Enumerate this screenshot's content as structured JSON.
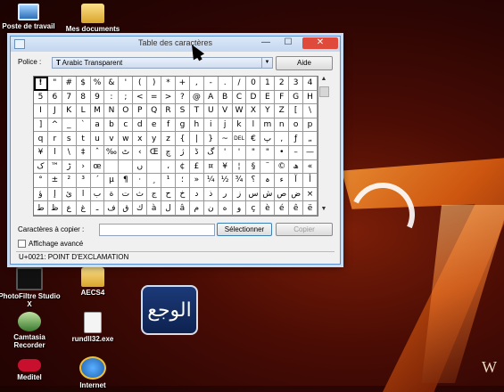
{
  "desktop": {
    "icons": [
      {
        "label": "Poste de travail",
        "icon": "computer-icon"
      },
      {
        "label": "Mes documents",
        "icon": "folder-icon"
      },
      {
        "label": "PhotoFiltre Studio X",
        "icon": "photofiltre-icon"
      },
      {
        "label": "AECS4",
        "icon": "folder-icon"
      },
      {
        "label": "Camtasia Recorder",
        "icon": "camtasia-icon"
      },
      {
        "label": "rundll32.exe",
        "icon": "exe-file-icon"
      },
      {
        "label": "Meditel",
        "icon": "meditel-icon"
      },
      {
        "label": "Internet",
        "icon": "internet-explorer-icon"
      }
    ],
    "logo_text": "الوجع",
    "corner_text": "W"
  },
  "window": {
    "title": "Table des caractères",
    "controls": {
      "minimize": "—",
      "maximize": "☐",
      "close": "✕"
    },
    "font_label": "Police :",
    "font_value": "Arabic Transparent",
    "font_icon": "truetype-icon",
    "help_label": "Aide",
    "characters": [
      "!",
      "\"",
      "#",
      "$",
      "%",
      "&",
      "'",
      "(",
      ")",
      "*",
      "+",
      ",",
      "-",
      ".",
      "/",
      "0",
      "1",
      "2",
      "3",
      "4",
      "5",
      "6",
      "7",
      "8",
      "9",
      ":",
      ";",
      "<",
      "=",
      ">",
      "?",
      "@",
      "A",
      "B",
      "C",
      "D",
      "E",
      "F",
      "G",
      "H",
      "I",
      "J",
      "K",
      "L",
      "M",
      "N",
      "O",
      "P",
      "Q",
      "R",
      "S",
      "T",
      "U",
      "V",
      "W",
      "X",
      "Y",
      "Z",
      "[",
      "\\",
      "]",
      "^",
      "_",
      "`",
      "a",
      "b",
      "c",
      "d",
      "e",
      "f",
      "g",
      "h",
      "i",
      "j",
      "k",
      "l",
      "m",
      "n",
      "o",
      "p",
      "q",
      "r",
      "s",
      "t",
      "u",
      "v",
      "w",
      "x",
      "y",
      "z",
      "{",
      "|",
      "}",
      "~",
      "DEL",
      "€",
      "پ",
      "‚",
      "ƒ",
      "„",
      "¥",
      "ا",
      "\\",
      "‡",
      "ˆ",
      "‰",
      "ٹ",
      "‹",
      "Œ",
      "چ",
      "ژ",
      "ڈ",
      "گ",
      "'",
      "'",
      "\"",
      "\"",
      "•",
      "–",
      "—",
      "ک",
      "™",
      "ڑ",
      "›",
      "œ",
      "‌",
      "‍",
      "ں",
      " ",
      "،",
      "¢",
      "£",
      "¤",
      "¥",
      "¦",
      "§",
      "¨",
      "©",
      "ھ",
      "«",
      "°",
      "±",
      "²",
      "³",
      "´",
      "µ",
      "¶",
      "·",
      "¸",
      "¹",
      "؛",
      "»",
      "¼",
      "½",
      "¾",
      "؟",
      "ہ",
      "ء",
      "آ",
      "أ",
      "ؤ",
      "إ",
      "ئ",
      "ا",
      "ب",
      "ة",
      "ت",
      "ث",
      "ج",
      "ح",
      "خ",
      "د",
      "ذ",
      "ر",
      "ز",
      "س",
      "ش",
      "ص",
      "ض",
      "×",
      "ط",
      "ظ",
      "ع",
      "غ",
      "ـ",
      "ف",
      "ق",
      "ك",
      "à",
      "ل",
      "â",
      "م",
      "ن",
      "ه",
      "و",
      "ç",
      "è",
      "é",
      "ê",
      "ë"
    ],
    "selected_index": 0,
    "copy_label": "Caractères à copier :",
    "copy_value": "",
    "select_label": "Sélectionner",
    "copy_button": "Copier",
    "advanced_label": "Affichage avancé",
    "advanced_checked": false,
    "status": "U+0021: POINT D'EXCLAMATION"
  }
}
